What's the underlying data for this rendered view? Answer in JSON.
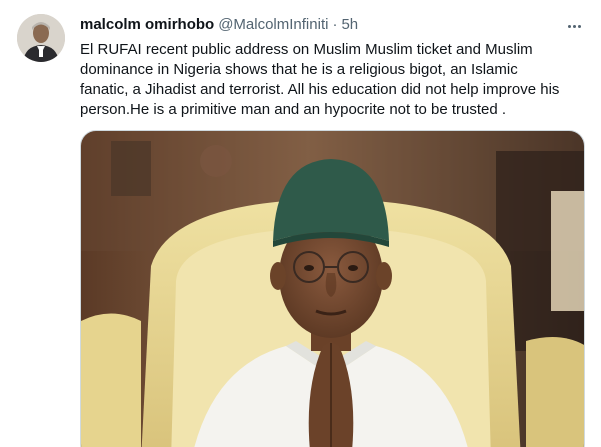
{
  "tweet": {
    "author": {
      "display_name": "malcolm omirhobo",
      "handle": "@MalcolmInfiniti",
      "separator": "·",
      "time": "5h"
    },
    "text_lines": [
      "El RUFAI recent public address on Muslim Muslim ticket and Muslim",
      "dominance in Nigeria shows that he is a  religious bigot, an Islamic",
      "fanatic, a Jihadist and terrorist. All his education did not help improve his",
      "person.He is a primitive man and an hypocrite not to be trusted ."
    ],
    "icons": {
      "more": "more-options-icon",
      "avatar": "profile-avatar"
    },
    "colors": {
      "text_primary": "#0f1419",
      "text_secondary": "#536471",
      "border": "#cfd9de"
    }
  }
}
